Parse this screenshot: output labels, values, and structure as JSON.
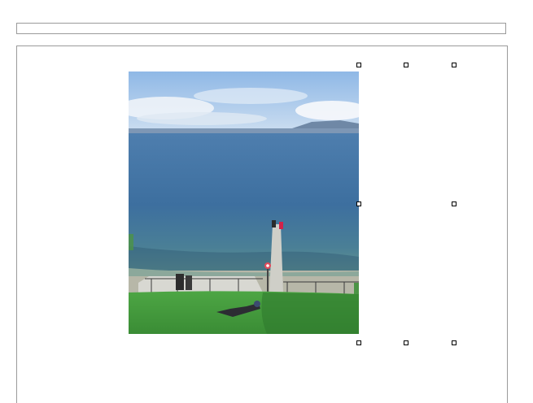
{
  "toolbar": {
    "field_value": ""
  },
  "image": {
    "subject": "lake-pier-photo",
    "colors": {
      "sky": "#9fc3ea",
      "lake": "#3f72a3",
      "shallows": "#5f8f86",
      "grass": "#3f9a3c",
      "pier": "#c9c9c1"
    }
  },
  "selection": {
    "handle_count": 8
  }
}
